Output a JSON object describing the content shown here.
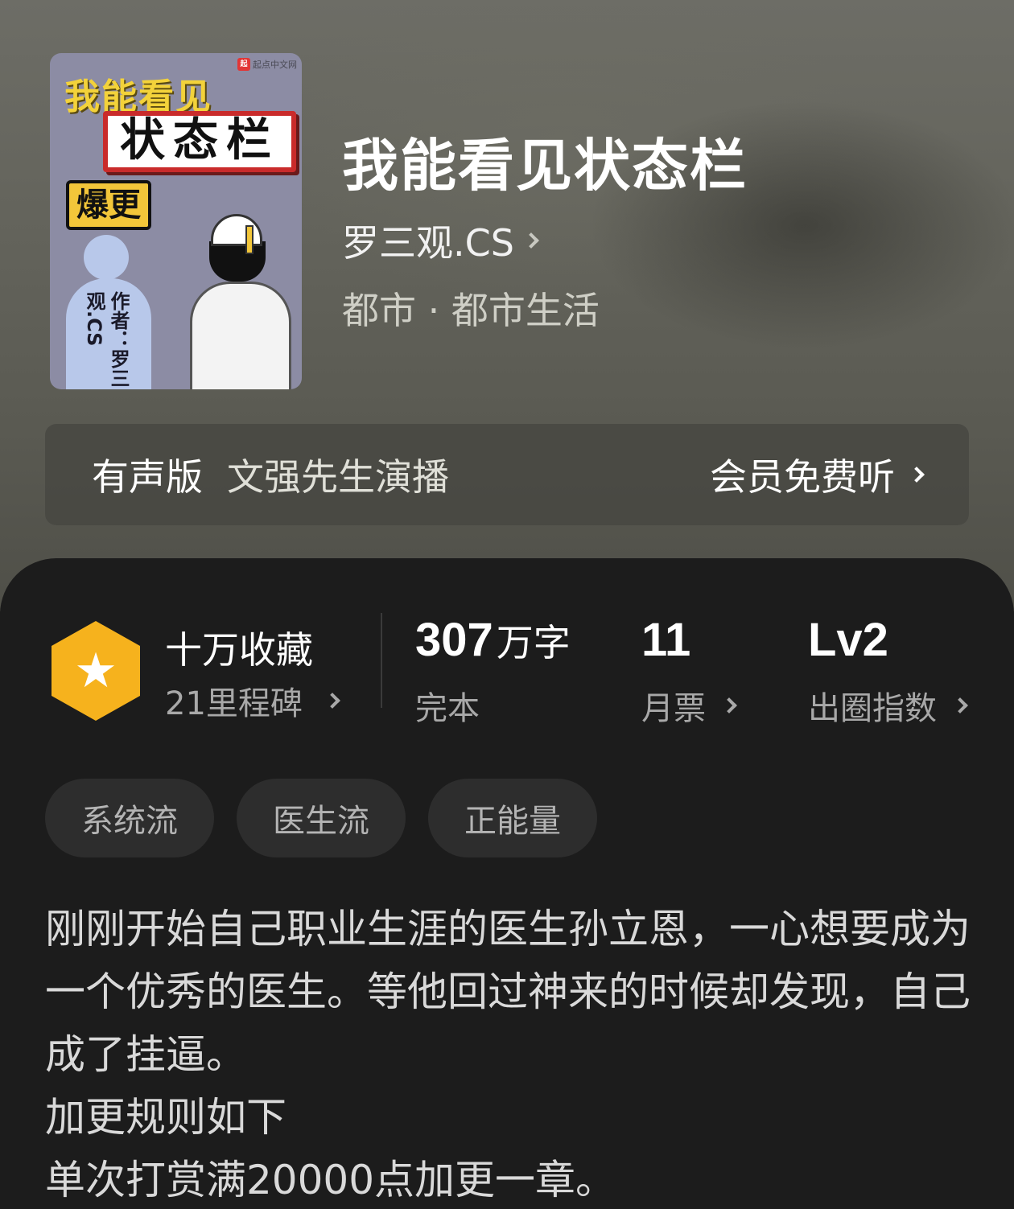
{
  "cover": {
    "brand": "起点中文网",
    "brand_logo": "起",
    "line1": "我能看见",
    "box_text": "状态栏",
    "badge": "爆更",
    "author_vertical": "作者：罗三观.CS"
  },
  "book": {
    "title": "我能看见状态栏",
    "author": "罗三观.CS",
    "genre": "都市 · 都市生活"
  },
  "audio": {
    "label": "有声版",
    "narrator": "文强先生演播",
    "cta": "会员免费听"
  },
  "stats": {
    "favorites_main": "十万收藏",
    "favorites_sub": "21里程碑",
    "words_num": "307",
    "words_unit": "万字",
    "words_status": "完本",
    "monthly_num": "11",
    "monthly_label": "月票",
    "level_num": "Lv2",
    "level_label": "出圈指数"
  },
  "tags": [
    "系统流",
    "医生流",
    "正能量"
  ],
  "description": [
    "刚刚开始自己职业生涯的医生孙立恩，一心想要成为一个优秀的医生。等他回过神来的时候却发现，自己成了挂逼。",
    "加更规则如下",
    "单次打赏满20000点加更一章。"
  ],
  "colors": {
    "accent_hex": "#f6b21d",
    "panel_bg": "#1c1c1c"
  }
}
